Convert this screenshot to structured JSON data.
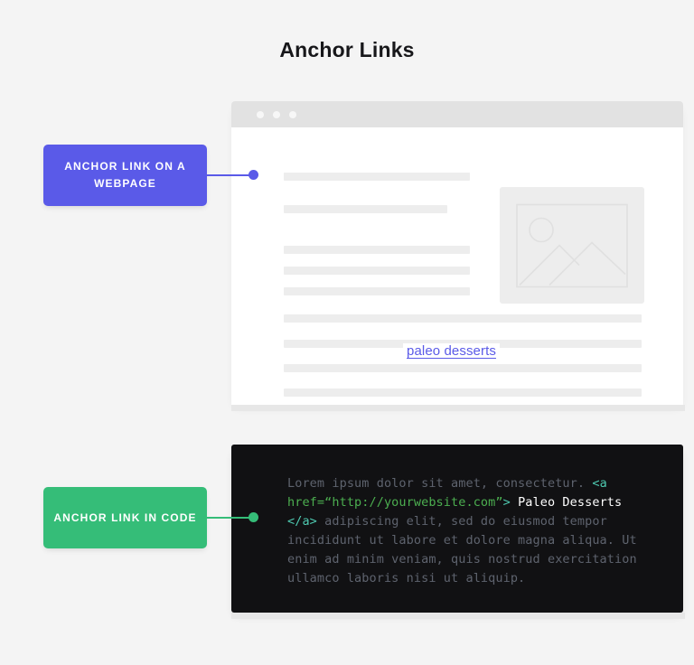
{
  "title": "Anchor Links",
  "colors": {
    "background": "#f4f4f4",
    "purple": "#5a5ae8",
    "green": "#35bd78",
    "code_background": "#111113",
    "code_comment": "#5e636e",
    "code_tag": "#4ec9b0",
    "code_attr": "#4caf50",
    "code_text": "#ffffff",
    "placeholder_bar": "#ededed",
    "titlebar": "#e2e2e2"
  },
  "callouts": [
    {
      "id": "anchor-link-on-a-webpage",
      "label": "ANCHOR LINK ON A WEBPAGE",
      "color": "#5a5ae8"
    },
    {
      "id": "anchor-link-in-code",
      "label": "ANCHOR LINK IN CODE",
      "color": "#35bd78"
    }
  ],
  "browser": {
    "window_dots": [
      "window-dot-1",
      "window-dot-2",
      "window-dot-3"
    ],
    "image_placeholder_icon": "image-placeholder-icon",
    "anchor_link_text": "paleo desserts"
  },
  "code": {
    "line_1": "Lorem ipsum dolor sit amet, consectetur.",
    "tag_open": "<a",
    "attribute": " href=“http://yourwebsite.com”",
    "tag_close_bracket": ">",
    "anchor_text": " Paleo Desserts ",
    "tag_end": "</a>",
    "line_rest": " adipiscing elit, sed do eiusmod tempor incididunt ut labore et dolore magna aliqua. Ut enim ad minim veniam, quis nostrud exercitation ullamco laboris nisi ut aliquip.",
    "full_text": "Lorem ipsum dolor sit amet, consectetur. <a href=“http://yourwebsite.com”> Paleo Desserts </a> adipiscing elit, sed do eiusmod tempor incididunt ut labore et dolore magna aliqua. Ut enim ad minim veniam, quis nostrud exercitation ullamco laboris nisi ut aliquip."
  }
}
